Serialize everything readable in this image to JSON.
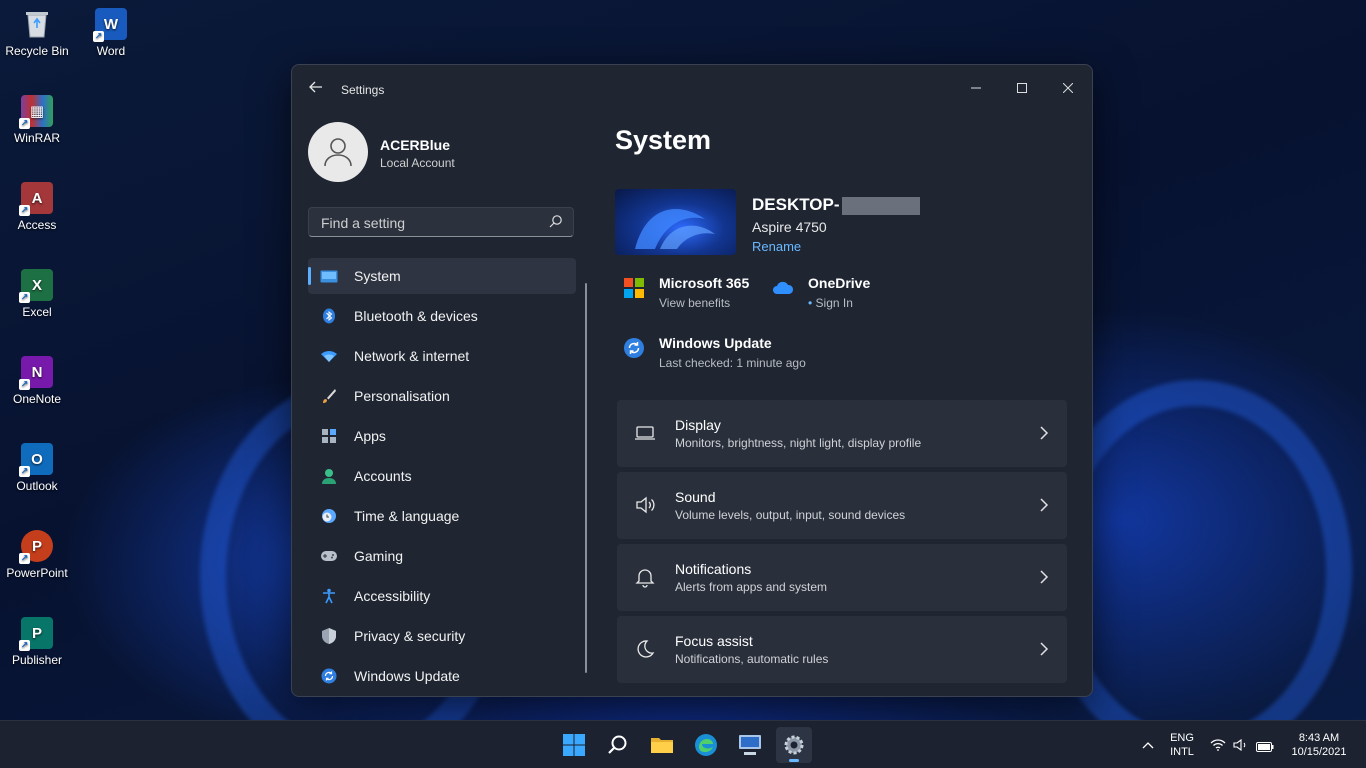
{
  "desktop": {
    "icons": [
      {
        "label": "Recycle Bin"
      },
      {
        "label": "Word"
      },
      {
        "label": "WinRAR"
      },
      {
        "label": "Access"
      },
      {
        "label": "Excel"
      },
      {
        "label": "OneNote"
      },
      {
        "label": "Outlook"
      },
      {
        "label": "PowerPoint"
      },
      {
        "label": "Publisher"
      }
    ]
  },
  "window": {
    "title": "Settings",
    "back_icon": "back-arrow-icon"
  },
  "profile": {
    "name": "ACERBlue",
    "account_type": "Local Account"
  },
  "search": {
    "placeholder": "Find a setting"
  },
  "nav": {
    "items": [
      {
        "label": "System",
        "icon": "system-icon",
        "active": true
      },
      {
        "label": "Bluetooth & devices",
        "icon": "bluetooth-icon"
      },
      {
        "label": "Network & internet",
        "icon": "wifi-icon"
      },
      {
        "label": "Personalisation",
        "icon": "brush-icon"
      },
      {
        "label": "Apps",
        "icon": "apps-icon"
      },
      {
        "label": "Accounts",
        "icon": "account-icon"
      },
      {
        "label": "Time & language",
        "icon": "clock-globe-icon"
      },
      {
        "label": "Gaming",
        "icon": "gamepad-icon"
      },
      {
        "label": "Accessibility",
        "icon": "accessibility-icon"
      },
      {
        "label": "Privacy & security",
        "icon": "shield-icon"
      },
      {
        "label": "Windows Update",
        "icon": "update-icon"
      }
    ]
  },
  "main": {
    "title": "System",
    "device": {
      "name": "DESKTOP-",
      "model": "Aspire 4750",
      "rename": "Rename"
    },
    "quick": {
      "m365": {
        "title": "Microsoft 365",
        "sub": "View benefits"
      },
      "onedrive": {
        "title": "OneDrive",
        "sub": "Sign In"
      },
      "update": {
        "title": "Windows Update",
        "sub": "Last checked: 1 minute ago"
      }
    },
    "cards": [
      {
        "title": "Display",
        "sub": "Monitors, brightness, night light, display profile",
        "icon": "monitor-icon"
      },
      {
        "title": "Sound",
        "sub": "Volume levels, output, input, sound devices",
        "icon": "speaker-icon"
      },
      {
        "title": "Notifications",
        "sub": "Alerts from apps and system",
        "icon": "bell-icon"
      },
      {
        "title": "Focus assist",
        "sub": "Notifications, automatic rules",
        "icon": "moon-icon"
      }
    ]
  },
  "taskbar": {
    "lang_top": "ENG",
    "lang_bottom": "INTL",
    "time": "8:43 AM",
    "date": "10/15/2021"
  },
  "colors": {
    "accent": "#5ab0ff",
    "window_bg": "#1f2632",
    "card_bg": "#2a303b"
  }
}
